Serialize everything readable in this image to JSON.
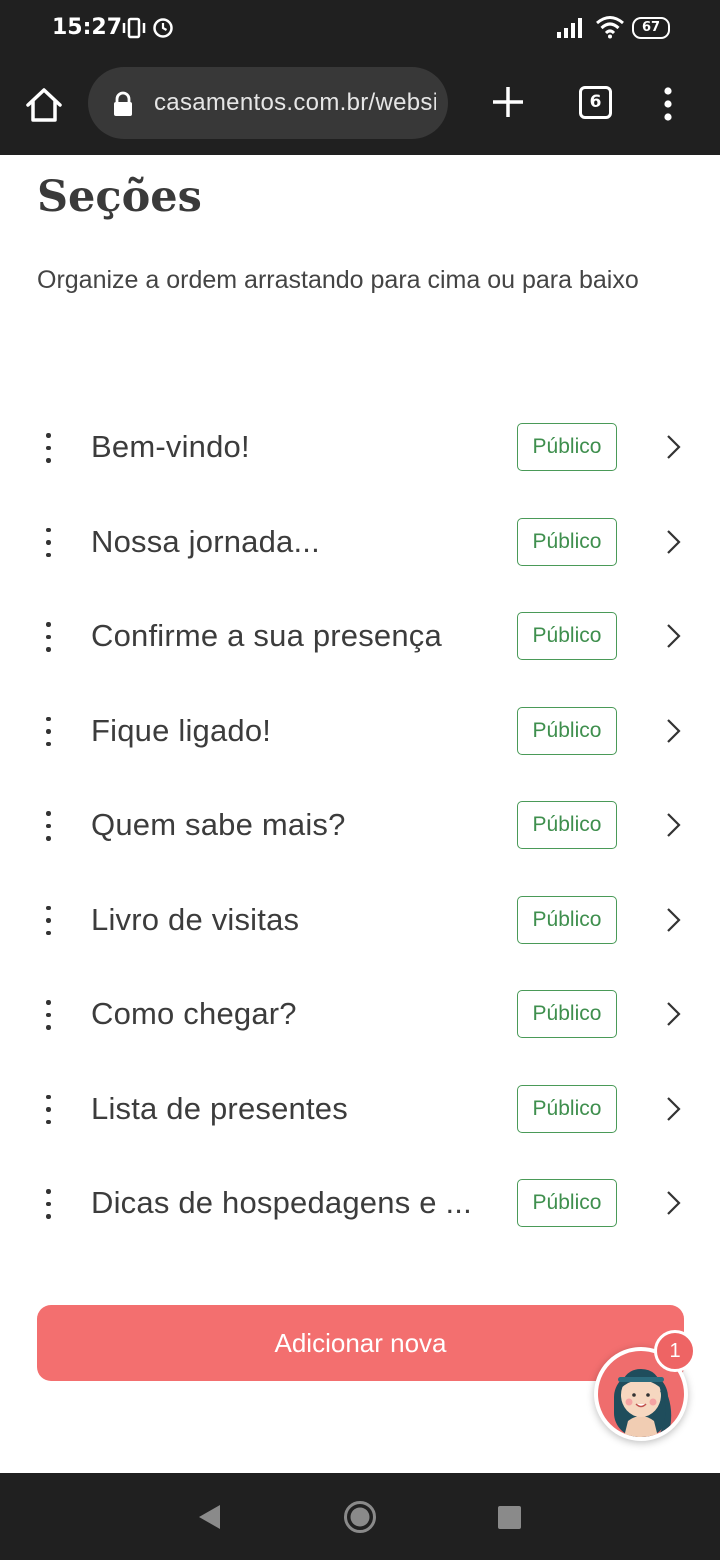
{
  "status_bar": {
    "time": "15:27",
    "battery": "67"
  },
  "browser": {
    "url": "casamentos.com.br/website",
    "tab_count": "6"
  },
  "page": {
    "title": "Seções",
    "subtitle": "Organize a ordem arrastando para cima ou para baixo"
  },
  "sections": [
    {
      "label": "Bem-vindo!",
      "status": "Público"
    },
    {
      "label": "Nossa jornada...",
      "status": "Público"
    },
    {
      "label": "Confirme a sua presença",
      "status": "Público"
    },
    {
      "label": "Fique ligado!",
      "status": "Público"
    },
    {
      "label": "Quem sabe mais?",
      "status": "Público"
    },
    {
      "label": "Livro de visitas",
      "status": "Público"
    },
    {
      "label": "Como chegar?",
      "status": "Público"
    },
    {
      "label": "Lista de presentes",
      "status": "Público"
    },
    {
      "label": "Dicas de hospedagens e ...",
      "status": "Público"
    }
  ],
  "actions": {
    "add_label": "Adicionar nova"
  },
  "chat": {
    "notification_count": "1"
  },
  "colors": {
    "accent": "#f36f6f",
    "badge_green": "#3f8f4e",
    "chrome_dark": "#202020"
  }
}
